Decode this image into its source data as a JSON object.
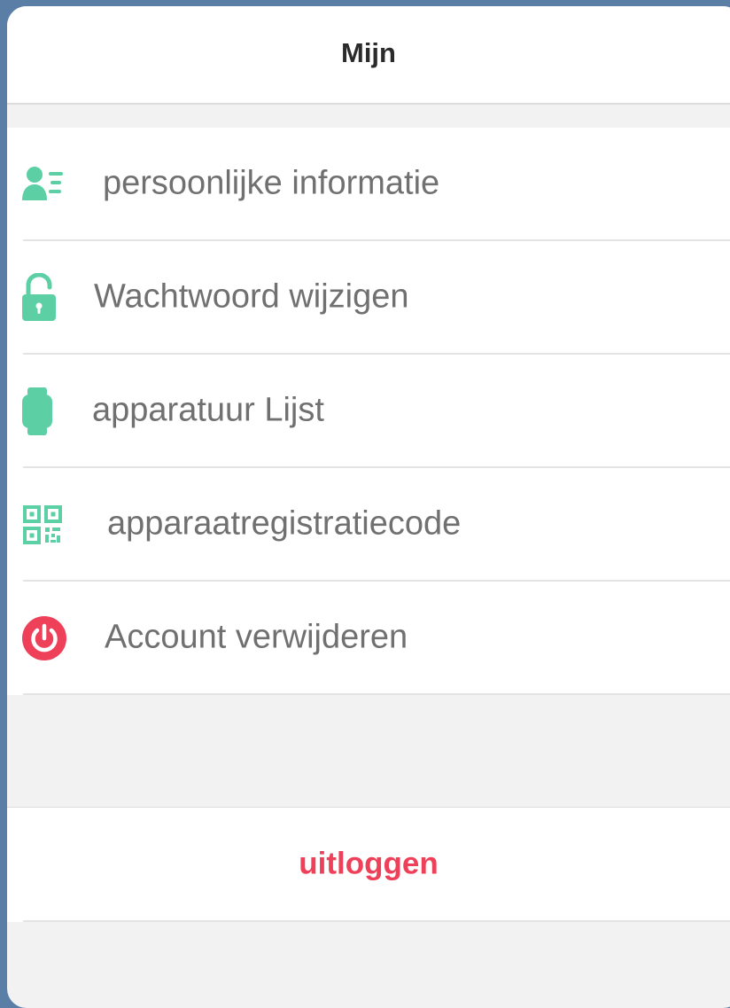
{
  "header": {
    "title": "Mijn"
  },
  "menu": {
    "items": [
      {
        "label": "persoonlijke informatie",
        "icon": "user-info-icon"
      },
      {
        "label": "Wachtwoord wijzigen",
        "icon": "unlock-icon"
      },
      {
        "label": "apparatuur Lijst",
        "icon": "smartwatch-icon"
      },
      {
        "label": "apparaatregistratiecode",
        "icon": "qr-code-icon"
      },
      {
        "label": "Account verwijderen",
        "icon": "power-icon"
      }
    ]
  },
  "logout": {
    "label": "uitloggen"
  },
  "colors": {
    "accent_green": "#5ccfa5",
    "danger_red": "#ee4059",
    "background": "#f2f2f2",
    "frame": "#5b7ea6"
  }
}
